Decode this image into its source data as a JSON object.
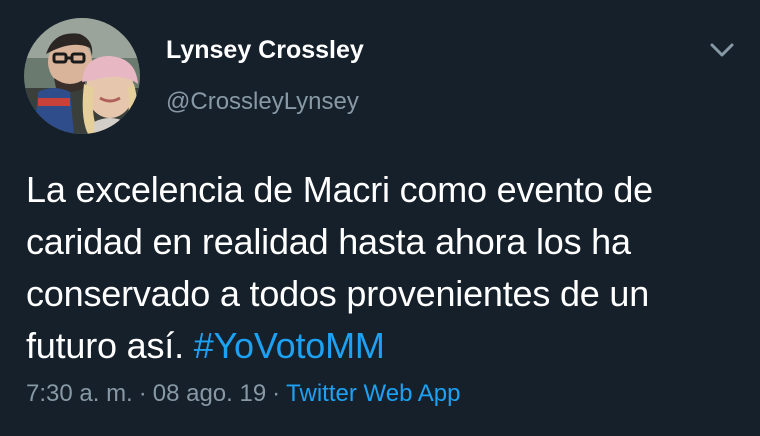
{
  "colors": {
    "background": "#15202b",
    "primary_text": "#ffffff",
    "secondary_text": "#8899a6",
    "link": "#1da1f2"
  },
  "author": {
    "display_name": "Lynsey Crossley",
    "handle": "@CrossleyLynsey",
    "avatar_icon": "profile-photo"
  },
  "menu": {
    "icon": "chevron-down-icon"
  },
  "tweet": {
    "text_lines": [
      "La excelencia de Macri como evento de",
      "caridad en realidad hasta ahora los ha",
      "conservado a todos provenientes de un",
      "futuro así. "
    ],
    "hashtag": "#YoVotoMM"
  },
  "meta": {
    "time": "7:30 a. m.",
    "separator": "·",
    "date": "08 ago. 19",
    "source": "Twitter Web App"
  }
}
